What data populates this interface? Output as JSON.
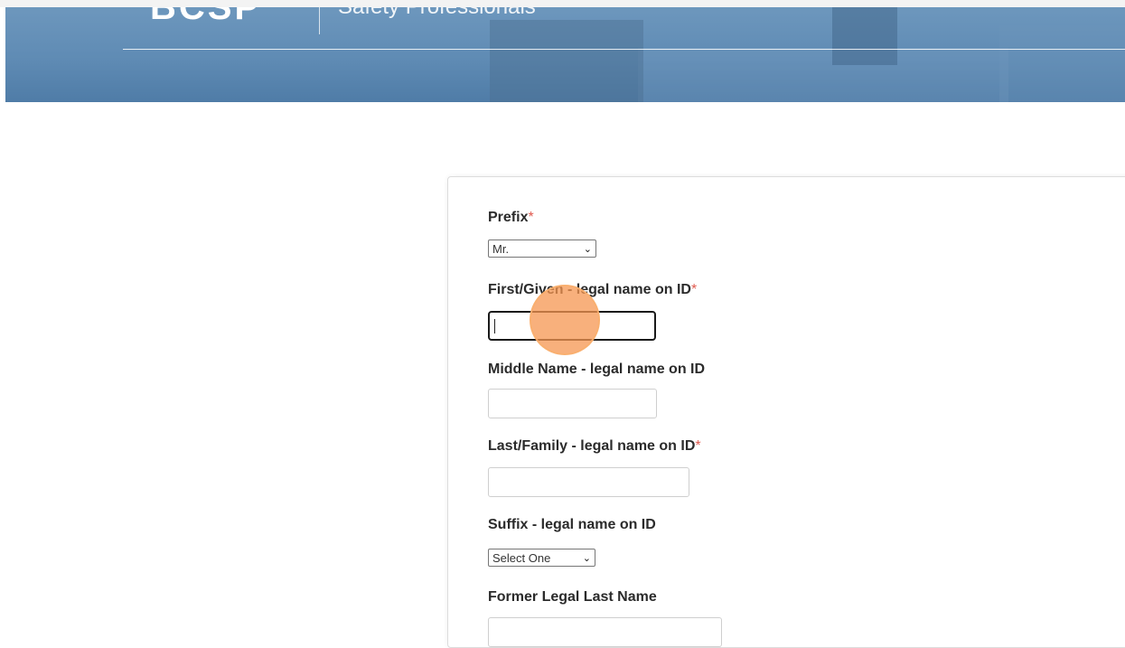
{
  "header": {
    "logo_text": "BCSP",
    "tagline": "Safety Professionals"
  },
  "form": {
    "prefix": {
      "label": "Prefix",
      "required_mark": "*",
      "selected": "Mr."
    },
    "first_name": {
      "label": "First/Given - legal name on ID",
      "required_mark": "*",
      "value": ""
    },
    "middle_name": {
      "label": "Middle Name - legal name on ID",
      "value": ""
    },
    "last_name": {
      "label": "Last/Family - legal name on ID",
      "required_mark": "*",
      "value": ""
    },
    "suffix": {
      "label": "Suffix - legal name on ID",
      "selected": "Select One"
    },
    "former_last_name": {
      "label": "Former Legal Last Name",
      "value": ""
    }
  },
  "colors": {
    "banner": "#5f8bb4",
    "required": "#e05a4f",
    "click_marker": "#f59650"
  },
  "icons": {
    "select_arrow": "chevron-down-icon",
    "click_marker": "click-marker-circle"
  }
}
